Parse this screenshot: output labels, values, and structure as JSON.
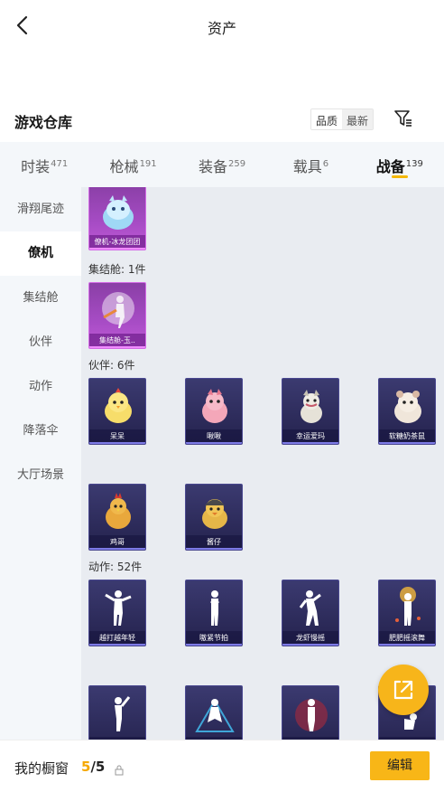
{
  "header": {
    "title": "资产"
  },
  "warehouse": {
    "title": "游戏仓库",
    "sort_options": [
      "品质",
      "最新"
    ]
  },
  "tabs": [
    {
      "label": "时装",
      "count": "471"
    },
    {
      "label": "枪械",
      "count": "191"
    },
    {
      "label": "装备",
      "count": "259"
    },
    {
      "label": "载具",
      "count": "6"
    },
    {
      "label": "战备",
      "count": "139"
    }
  ],
  "sidenav": [
    "滑翔尾迹",
    "僚机",
    "集结舱",
    "伙伴",
    "动作",
    "降落伞",
    "大厅场景"
  ],
  "groups": {
    "g1": {
      "label": "集结舱: 1件"
    },
    "g2": {
      "label": "伙伴: 6件"
    },
    "g3": {
      "label": "动作: 52件"
    }
  },
  "cards": {
    "c0": "僚机-冰龙团团",
    "c1": "集结舱-玉..",
    "c2": "呆呆",
    "c3": "啾啾",
    "c4": "幸运爱玛",
    "c5": "软糖奶茶鼠",
    "c6": "鸡哥",
    "c7": "酱仔",
    "c8": "越打越年轻",
    "c9": "嗷紧节拍",
    "c10": "龙虾慢摇",
    "c11": "肥肥摇滚舞",
    "c12": "",
    "c13": "",
    "c14": "",
    "c15": ""
  },
  "bottom": {
    "label": "我的橱窗",
    "count_current": "5",
    "count_total": "/5",
    "edit_label": "编辑"
  },
  "colors": {
    "accent": "#f5b800",
    "card_purple": "#a74cc5",
    "card_blue": "#2b2a5a"
  }
}
